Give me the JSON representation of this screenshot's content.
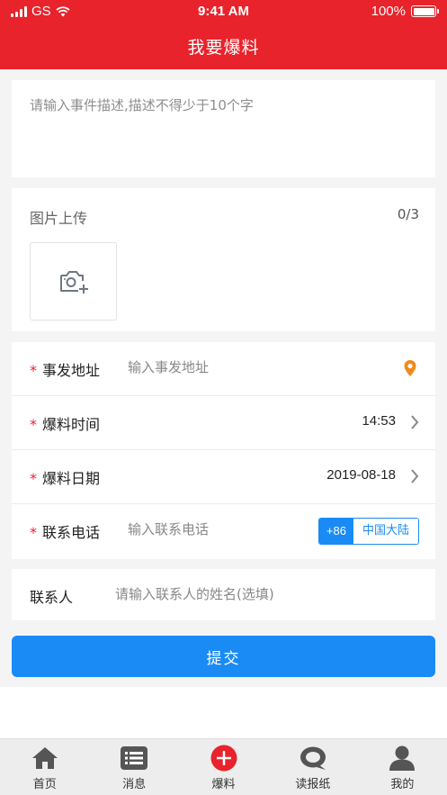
{
  "status_bar": {
    "carrier": "GS",
    "time": "9:41 AM",
    "battery": "100%"
  },
  "header": {
    "title": "我要爆料"
  },
  "description": {
    "placeholder": "请输入事件描述,描述不得少于10个字"
  },
  "image_upload": {
    "title": "图片上传",
    "count": "0/3",
    "icon": "camera-add-icon"
  },
  "form": {
    "required_mark": "*",
    "address": {
      "label": "事发地址",
      "placeholder": "输入事发地址",
      "icon": "location-pin-icon"
    },
    "time": {
      "label": "爆料时间",
      "value": "14:53"
    },
    "date": {
      "label": "爆料日期",
      "value": "2019-08-18"
    },
    "phone": {
      "label": "联系电话",
      "placeholder": "输入联系电话",
      "region_code": "+86",
      "region_name": "中国大陆"
    }
  },
  "contact": {
    "label": "联系人",
    "placeholder": "请输入联系人的姓名(选填)"
  },
  "submit": {
    "label": "提交"
  },
  "tabbar": {
    "items": [
      {
        "label": "首页",
        "icon": "home-icon"
      },
      {
        "label": "消息",
        "icon": "message-list-icon"
      },
      {
        "label": "爆料",
        "icon": "plus-circle-icon"
      },
      {
        "label": "读报纸",
        "icon": "newspaper-icon"
      },
      {
        "label": "我的",
        "icon": "user-icon"
      }
    ]
  },
  "colors": {
    "brand_red": "#e8232b",
    "accent_blue": "#1a8bf5",
    "location_orange": "#f08a1c",
    "tab_icon_gray": "#555555"
  }
}
